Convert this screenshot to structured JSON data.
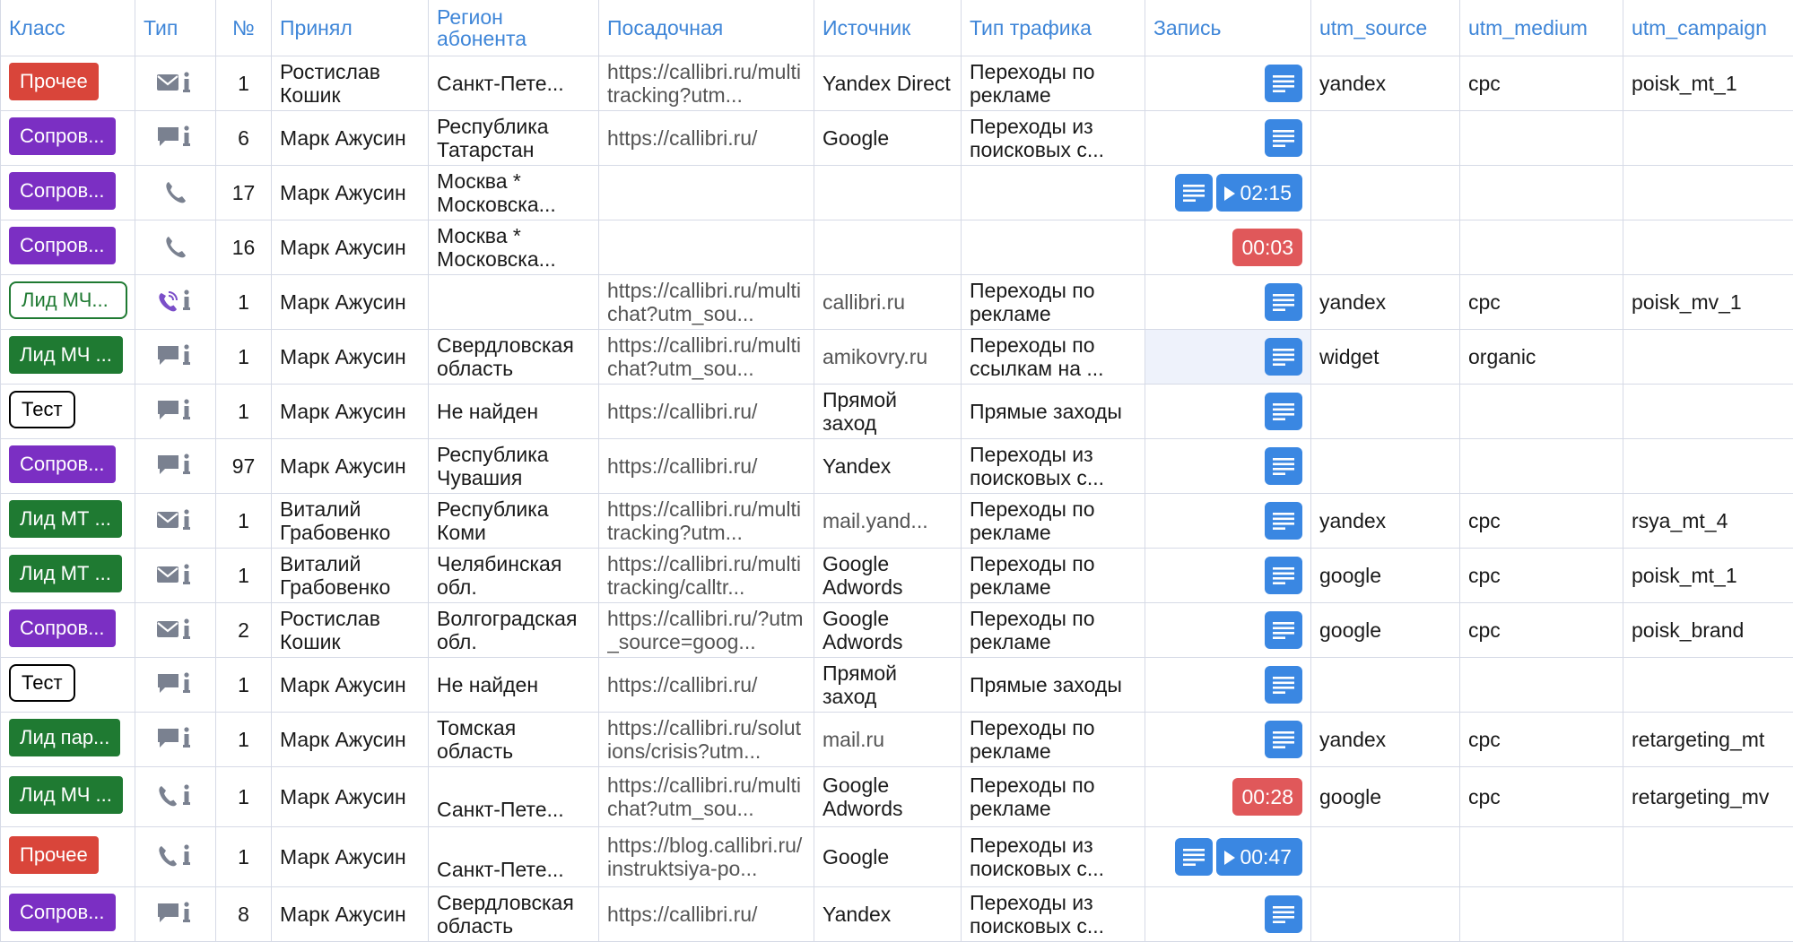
{
  "headers": [
    "Класс",
    "Тип",
    "№",
    "Принял",
    "Регион абонента",
    "Посадочная",
    "Источник",
    "Тип трафика",
    "Запись",
    "utm_source",
    "utm_medium",
    "utm_campaign"
  ],
  "colors": {
    "header": "#3f86d8",
    "red": "#d9453a",
    "purple": "#7b2fc3",
    "green": "#1f7a32",
    "button": "#3a87e2",
    "duration_red": "#e0585a"
  },
  "rows": [
    {
      "klass": "Прочее",
      "badge": "red",
      "type_icon": "envelope-icon",
      "num": "1",
      "accepted": "Ростислав Кошик",
      "region": "Санкт-Пете...",
      "landing": "https://callibri.ru/multitracking?utm...",
      "source": "Yandex Direct",
      "traffic": "Переходы по рекламе",
      "rec_doc": true,
      "rec_duration": "",
      "rec_style": "",
      "utm_source": "yandex",
      "utm_medium": "cpc",
      "utm_campaign": "poisk_mt_1"
    },
    {
      "klass": "Сопров...",
      "badge": "purple",
      "type_icon": "chat-icon",
      "num": "6",
      "accepted": "Марк Ажусин",
      "region": "Республика Татарстан",
      "landing": "https://callibri.ru/",
      "source": "Google",
      "traffic": "Переходы из поисковых с...",
      "rec_doc": true,
      "rec_duration": "",
      "rec_style": "",
      "utm_source": "",
      "utm_medium": "",
      "utm_campaign": ""
    },
    {
      "klass": "Сопров...",
      "badge": "purple",
      "type_icon": "phone-icon",
      "num": "17",
      "accepted": "Марк Ажусин",
      "region": "Москва * Московска...",
      "landing": "",
      "source": "",
      "traffic": "",
      "rec_doc": true,
      "rec_duration": "02:15",
      "rec_style": "play",
      "utm_source": "",
      "utm_medium": "",
      "utm_campaign": ""
    },
    {
      "klass": "Сопров...",
      "badge": "purple",
      "type_icon": "phone-icon",
      "num": "16",
      "accepted": "Марк Ажусин",
      "region": "Москва * Московска...",
      "landing": "",
      "source": "",
      "traffic": "",
      "rec_doc": false,
      "rec_duration": "00:03",
      "rec_style": "red",
      "utm_source": "",
      "utm_medium": "",
      "utm_campaign": ""
    },
    {
      "klass": "Лид МЧ...",
      "badge": "outline-green",
      "type_icon": "viber-icon",
      "num": "1",
      "accepted": "Марк Ажусин",
      "region": "",
      "landing": "https://callibri.ru/multichat?utm_sou...",
      "source": "callibri.ru",
      "source_muted": true,
      "traffic": "Переходы по рекламе",
      "rec_doc": true,
      "rec_duration": "",
      "rec_style": "",
      "utm_source": "yandex",
      "utm_medium": "cpc",
      "utm_campaign": "poisk_mv_1"
    },
    {
      "klass": "Лид МЧ ...",
      "badge": "green",
      "type_icon": "chat-icon",
      "num": "1",
      "accepted": "Марк Ажусин",
      "region": "Свердловская область",
      "landing": "https://callibri.ru/multichat?utm_sou...",
      "source": "amikovry.ru",
      "source_muted": true,
      "traffic": "Переходы по ссылкам на ...",
      "rec_doc": true,
      "rec_duration": "",
      "rec_style": "",
      "rec_highlight": true,
      "utm_source": "widget",
      "utm_medium": "organic",
      "utm_campaign": ""
    },
    {
      "klass": "Тест",
      "badge": "outline-black",
      "type_icon": "chat-icon",
      "num": "1",
      "accepted": "Марк Ажусин",
      "region": "Не найден",
      "landing": "https://callibri.ru/",
      "source": "Прямой заход",
      "traffic": "Прямые заходы",
      "rec_doc": true,
      "rec_duration": "",
      "rec_style": "",
      "utm_source": "",
      "utm_medium": "",
      "utm_campaign": ""
    },
    {
      "klass": "Сопров...",
      "badge": "purple",
      "type_icon": "chat-icon",
      "num": "97",
      "accepted": "Марк Ажусин",
      "region": "Республика Чувашия",
      "landing": "https://callibri.ru/",
      "source": "Yandex",
      "traffic": "Переходы из поисковых с...",
      "rec_doc": true,
      "rec_duration": "",
      "rec_style": "",
      "utm_source": "",
      "utm_medium": "",
      "utm_campaign": ""
    },
    {
      "klass": "Лид МТ ...",
      "badge": "green",
      "type_icon": "envelope-icon",
      "num": "1",
      "accepted": "Виталий Грабовенко",
      "region": "Республика Коми",
      "landing": "https://callibri.ru/multitracking?utm...",
      "source": "mail.yand...",
      "source_muted": true,
      "traffic": "Переходы по рекламе",
      "rec_doc": true,
      "rec_duration": "",
      "rec_style": "",
      "utm_source": "yandex",
      "utm_medium": "cpc",
      "utm_campaign": "rsya_mt_4"
    },
    {
      "klass": "Лид МТ ...",
      "badge": "green",
      "type_icon": "envelope-icon",
      "num": "1",
      "accepted": "Виталий Грабовенко",
      "region": "Челябинская обл.",
      "landing": "https://callibri.ru/multitracking/calltr...",
      "source": "Google Adwords",
      "traffic": "Переходы по рекламе",
      "rec_doc": true,
      "rec_duration": "",
      "rec_style": "",
      "utm_source": "google",
      "utm_medium": "cpc",
      "utm_campaign": "poisk_mt_1"
    },
    {
      "klass": "Сопров...",
      "badge": "purple",
      "type_icon": "envelope-icon",
      "num": "2",
      "accepted": "Ростислав Кошик",
      "region": "Волгоградская обл.",
      "landing": "https://callibri.ru/?utm_source=goog...",
      "source": "Google Adwords",
      "traffic": "Переходы по рекламе",
      "rec_doc": true,
      "rec_duration": "",
      "rec_style": "",
      "utm_source": "google",
      "utm_medium": "cpc",
      "utm_campaign": "poisk_brand"
    },
    {
      "klass": "Тест",
      "badge": "outline-black",
      "type_icon": "chat-icon",
      "num": "1",
      "accepted": "Марк Ажусин",
      "region": "Не найден",
      "landing": "https://callibri.ru/",
      "source": "Прямой заход",
      "traffic": "Прямые заходы",
      "rec_doc": true,
      "rec_duration": "",
      "rec_style": "",
      "utm_source": "",
      "utm_medium": "",
      "utm_campaign": ""
    },
    {
      "klass": "Лид пар...",
      "badge": "green",
      "type_icon": "chat-icon",
      "num": "1",
      "accepted": "Марк Ажусин",
      "region": "Томская область",
      "landing": "https://callibri.ru/solutions/crisis?utm...",
      "source": "mail.ru",
      "source_muted": true,
      "traffic": "Переходы по рекламе",
      "rec_doc": true,
      "rec_duration": "",
      "rec_style": "",
      "utm_source": "yandex",
      "utm_medium": "cpc",
      "utm_campaign": "retargeting_mt"
    },
    {
      "klass": "Лид МЧ ...",
      "badge": "green",
      "type_icon": "phone-info-icon",
      "num": "1",
      "accepted": "Марк Ажусин",
      "region": "Санкт-Пете...",
      "region_bottom": true,
      "landing": "https://callibri.ru/multichat?utm_sou...",
      "source": "Google Adwords",
      "traffic": "Переходы по рекламе",
      "rec_doc": false,
      "rec_duration": "00:28",
      "rec_style": "red",
      "utm_source": "google",
      "utm_medium": "cpc",
      "utm_campaign": "retargeting_mv"
    },
    {
      "klass": "Прочее",
      "badge": "red",
      "type_icon": "phone-info-icon",
      "num": "1",
      "accepted": "Марк Ажусин",
      "region": "Санкт-Пете...",
      "region_bottom": true,
      "landing": "https://blog.callibri.ru/instruktsiya-po...",
      "source": "Google",
      "traffic": "Переходы из поисковых с...",
      "rec_doc": true,
      "rec_duration": "00:47",
      "rec_style": "play",
      "utm_source": "",
      "utm_medium": "",
      "utm_campaign": ""
    },
    {
      "klass": "Сопров...",
      "badge": "purple",
      "type_icon": "chat-icon",
      "num": "8",
      "accepted": "Марк Ажусин",
      "region": "Свердловская область",
      "landing": "https://callibri.ru/",
      "source": "Yandex",
      "traffic": "Переходы из поисковых с...",
      "rec_doc": true,
      "rec_duration": "",
      "rec_style": "",
      "utm_source": "",
      "utm_medium": "",
      "utm_campaign": ""
    }
  ]
}
